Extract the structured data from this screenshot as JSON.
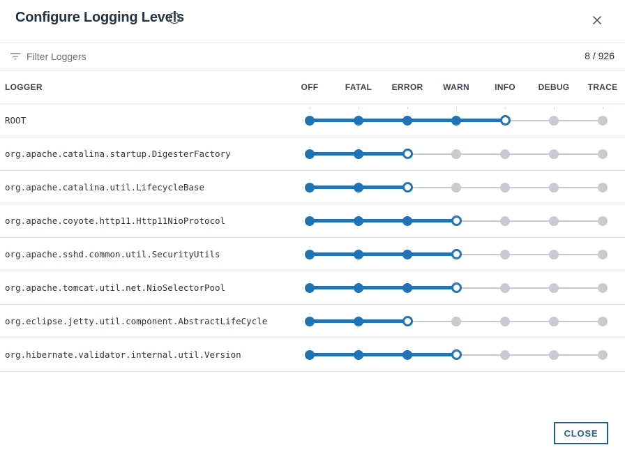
{
  "dialog": {
    "title": "Configure Logging Levels",
    "close_button_label": "CLOSE"
  },
  "filter": {
    "placeholder": "Filter Loggers",
    "value": "",
    "count": "8 / 926"
  },
  "table": {
    "logger_header": "LOGGER",
    "levels": [
      "OFF",
      "FATAL",
      "ERROR",
      "WARN",
      "INFO",
      "DEBUG",
      "TRACE"
    ],
    "rows": [
      {
        "name": "ROOT",
        "level": "INFO"
      },
      {
        "name": "org.apache.catalina.startup.DigesterFactory",
        "level": "ERROR"
      },
      {
        "name": "org.apache.catalina.util.LifecycleBase",
        "level": "ERROR"
      },
      {
        "name": "org.apache.coyote.http11.Http11NioProtocol",
        "level": "WARN"
      },
      {
        "name": "org.apache.sshd.common.util.SecurityUtils",
        "level": "WARN"
      },
      {
        "name": "org.apache.tomcat.util.net.NioSelectorPool",
        "level": "WARN"
      },
      {
        "name": "org.eclipse.jetty.util.component.AbstractLifeCycle",
        "level": "ERROR"
      },
      {
        "name": "org.hibernate.validator.internal.util.Version",
        "level": "WARN"
      }
    ]
  },
  "colors": {
    "accent": "#1f73b7",
    "inactive": "#c5cbd0",
    "button_border": "#1f5f8f"
  },
  "icons": {
    "info": "info-circle-icon",
    "close": "close-icon",
    "filter": "filter-lines-icon"
  }
}
